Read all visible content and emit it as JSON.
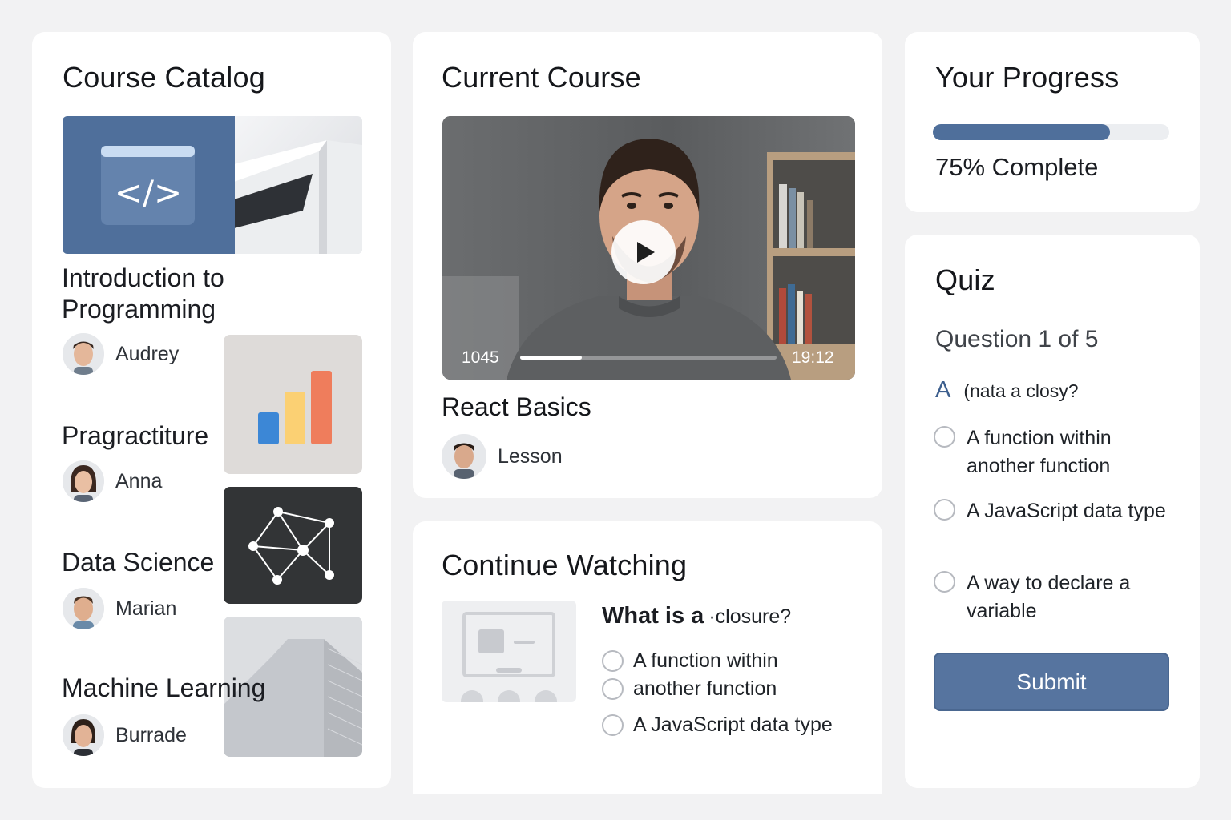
{
  "catalog": {
    "title": "Course Catalog",
    "courses": [
      {
        "title": "Introduction to Programming",
        "author": "Audrey"
      },
      {
        "title": "Pragractiture",
        "author": "Anna"
      },
      {
        "title": "Data Science",
        "author": "Marian"
      },
      {
        "title": "Machine Learning",
        "author": "Burrade"
      }
    ],
    "chart_colors": [
      "#3c87d6",
      "#fbd073",
      "#ef7d5c"
    ]
  },
  "current": {
    "title": "Current Course",
    "course_name": "React Basics",
    "lesson_label": "Lesson",
    "video": {
      "time_elapsed": "1045",
      "time_total": "19:12",
      "progress": 0.24
    }
  },
  "continue": {
    "title": "Continue Watching",
    "question_prefix": "What is a",
    "question_rest": "·closure?",
    "options": [
      "A function within",
      "another function",
      "A JavaScript data type"
    ]
  },
  "progress": {
    "title": "Your Progress",
    "percent": 75,
    "label": "75% Complete"
  },
  "quiz": {
    "title": "Quiz",
    "counter": "Question 1 of 5",
    "question_letter": "A",
    "question_text": "(nata a closy?",
    "options": [
      "A function within another function",
      "A JavaScript data type",
      "A way to declare a variable"
    ],
    "submit_label": "Submit"
  },
  "colors": {
    "accent": "#56749f",
    "progress": "#4f6f9b"
  }
}
